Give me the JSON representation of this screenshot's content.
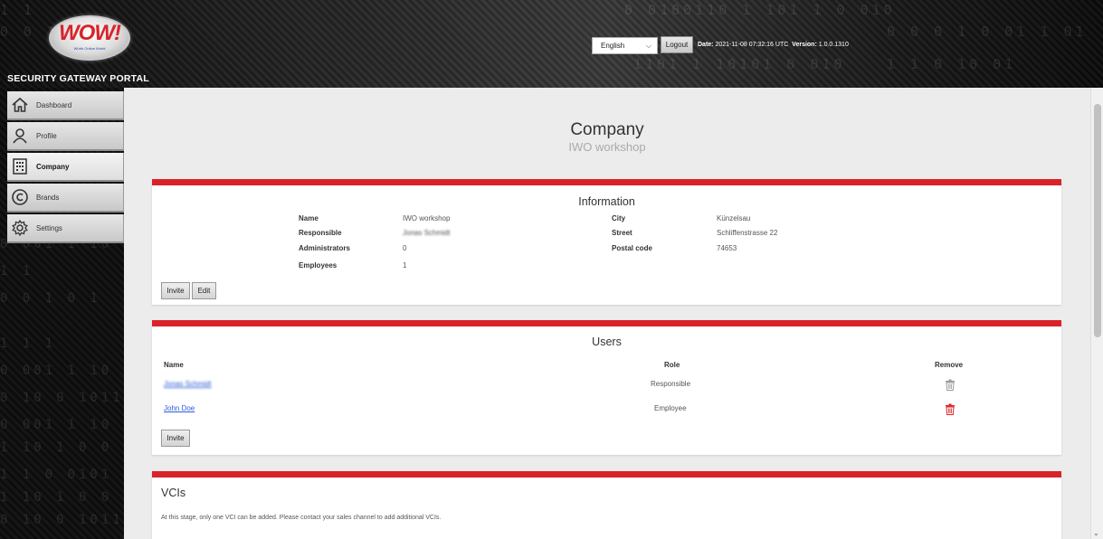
{
  "header": {
    "logo_text": "WOW!",
    "logo_sub": "Würth Online World",
    "portal_title": "SECURITY GATEWAY PORTAL",
    "language": "English",
    "logout_label": "Logout",
    "date_label": "Date:",
    "date_value": "2021-11-08 07:32:16 UTC",
    "version_label": "Version:",
    "version_value": "1.0.0.1310"
  },
  "sidebar": {
    "items": [
      {
        "label": "Dashboard",
        "icon": "home-icon"
      },
      {
        "label": "Profile",
        "icon": "user-icon"
      },
      {
        "label": "Company",
        "icon": "building-icon",
        "active": true
      },
      {
        "label": "Brands",
        "icon": "copyright-icon"
      },
      {
        "label": "Settings",
        "icon": "gear-icon"
      }
    ]
  },
  "page": {
    "title": "Company",
    "subtitle": "IWO workshop"
  },
  "information": {
    "title": "Information",
    "left": [
      {
        "label": "Name",
        "value": "IWO workshop"
      },
      {
        "label": "Responsible",
        "value": "Jonas Schmidt"
      },
      {
        "label": "Administrators",
        "value": "0"
      },
      {
        "label": "Employees",
        "value": "1"
      }
    ],
    "right": [
      {
        "label": "City",
        "value": "Künzelsau"
      },
      {
        "label": "Street",
        "value": "Schliffenstrasse 22"
      },
      {
        "label": "Postal code",
        "value": "74653"
      }
    ],
    "invite_label": "Invite",
    "edit_label": "Edit"
  },
  "users": {
    "title": "Users",
    "columns": {
      "name": "Name",
      "role": "Role",
      "remove": "Remove"
    },
    "rows": [
      {
        "name": "Jonas Schmidt",
        "role": "Responsible",
        "removable": false
      },
      {
        "name": "John Doe",
        "role": "Employee",
        "removable": true
      }
    ],
    "invite_label": "Invite"
  },
  "vcis": {
    "title": "VCIs",
    "notice": "At this stage, only one VCI can be added. Please contact your sales channel to add additional VCIs."
  },
  "colors": {
    "accent_red": "#d8232a",
    "link_blue": "#2a5bd7",
    "disabled_gray": "#9a9a9a"
  }
}
